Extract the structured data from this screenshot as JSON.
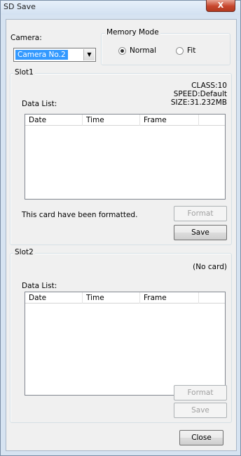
{
  "window": {
    "title": "SD Save",
    "close_glyph": "X"
  },
  "camera": {
    "label": "Camera:",
    "selected": "Camera No.2"
  },
  "memory_mode": {
    "title": "Memory Mode",
    "options": [
      {
        "label": "Normal",
        "selected": true
      },
      {
        "label": "Fit",
        "selected": false
      }
    ]
  },
  "slot1": {
    "title": "Slot1",
    "info": {
      "class": "CLASS:10",
      "speed": "SPEED:Default",
      "size": "SIZE:31.232MB"
    },
    "data_list_label": "Data List:",
    "columns": [
      "Date",
      "Time",
      "Frame"
    ],
    "status": "This card have been formatted.",
    "format_label": "Format",
    "save_label": "Save",
    "format_enabled": false,
    "save_enabled": true
  },
  "slot2": {
    "title": "Slot2",
    "status": "(No card)",
    "data_list_label": "Data List:",
    "columns": [
      "Date",
      "Time",
      "Frame"
    ],
    "format_label": "Format",
    "save_label": "Save",
    "format_enabled": false,
    "save_enabled": false
  },
  "close_label": "Close"
}
